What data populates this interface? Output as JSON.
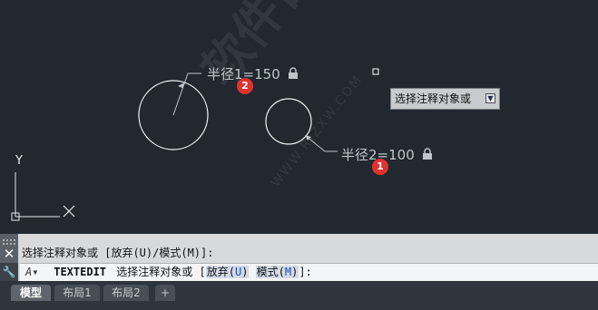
{
  "canvas": {
    "dim1_text": "半径1=150",
    "dim2_text": "半径2=100",
    "badge1": "1",
    "badge2": "2",
    "lock_icon": "lock-icon",
    "axis_y_label": "Y",
    "tooltip_text": "选择注释对象或"
  },
  "watermark": {
    "text": "软件自学网",
    "url": "WWW.RJZXW.COM"
  },
  "command": {
    "history_line": "选择注释对象或 [放弃(U)/模式(M)]:",
    "prompt_icon": "A",
    "command_name": "TEXTEDIT",
    "prompt_text": "选择注释对象或 [",
    "option1_label": "放弃(",
    "option1_key": "U",
    "option1_end": ")",
    "option2_label": "模式(",
    "option2_key": "M",
    "option2_end": ")",
    "prompt_end": "]:"
  },
  "tabs": [
    {
      "label": "模型"
    },
    {
      "label": "布局1"
    },
    {
      "label": "布局2"
    },
    {
      "label": "+"
    }
  ],
  "colors": {
    "canvas_bg": "#212830",
    "badge": "#e0322e",
    "option_key": "#1a4bbf"
  }
}
